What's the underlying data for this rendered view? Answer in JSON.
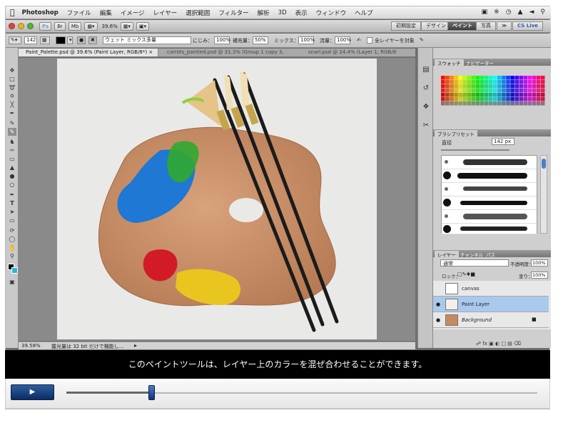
{
  "menubar": {
    "app_name": "Photoshop",
    "items": [
      "ファイル",
      "編集",
      "イメージ",
      "レイヤー",
      "選択範囲",
      "フィルター",
      "解析",
      "3D",
      "表示",
      "ウィンドウ",
      "ヘルプ"
    ]
  },
  "appbar": {
    "zoom": "39.6%",
    "workspaces": [
      "初期設定",
      "デザイン",
      "ペイント",
      "写真"
    ],
    "active_workspace": "ペイント",
    "more": "≫",
    "cslive": "CS Live"
  },
  "options": {
    "brush_size": "142",
    "mix_preset": "ウェット ミックス多量",
    "wet_label": "にじみ：",
    "wet_value": "100%",
    "load_label": "補充量：",
    "load_value": "50%",
    "mix_label": "ミックス：",
    "mix_value": "100%",
    "flow_label": "流量：",
    "flow_value": "100%",
    "sample_all": "全レイヤーを対象"
  },
  "tabs": [
    "Paint_Palette.psd @ 39.6% (Paint Layer, RGB/8*) ×",
    "carrots_painted.psd @ 31.3% (Group 1 copy 3,",
    "snarl.psd @ 24.4% (Layer 1, RGB/8"
  ],
  "status": {
    "zoom": "39.58%",
    "message": "露光量は 32 bit だけで機能し..."
  },
  "panels": {
    "swatches_tab": "スウォッチ",
    "navigator_tab": "ナビゲーター",
    "brush_preset_title": "ブラシプリセット",
    "diameter_label": "直径",
    "diameter_value": "142 px",
    "layers_tab": "レイヤー",
    "channels_tab": "チャンネル",
    "paths_tab": "パス",
    "blend_mode": "通常",
    "opacity_label": "不透明度：",
    "opacity_value": "100%",
    "lock_label": "ロック：",
    "fill_label": "塗り：",
    "fill_value": "100%",
    "layers": [
      "canvas",
      "Paint Layer",
      "Background"
    ]
  },
  "caption": "このペイントツールは、レイヤー上のカラーを混ぜ合わせることができます。",
  "video": {
    "progress": 0.18
  }
}
